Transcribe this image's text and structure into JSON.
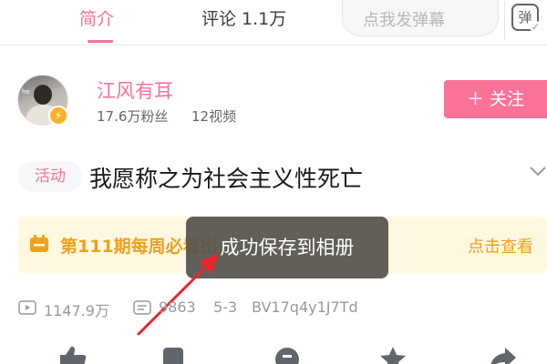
{
  "tabs": {
    "intro": "简介",
    "comments": "评论 1.1万"
  },
  "danmaku": {
    "placeholder": "点我发弹幕",
    "button_char": "弹"
  },
  "author": {
    "name": "江风有耳",
    "fans": "17.6万粉丝",
    "videos": "12视频",
    "avatar_tag": "he"
  },
  "follow_button": "＋ 关注",
  "activity_tag": "活动",
  "title": "我愿称之为社会主义性死亡",
  "banner": {
    "text": "第111期每周必看",
    "suffix": "出",
    "link": "点击查看"
  },
  "toast": "成功保存到相册",
  "stats": {
    "views": "1147.9万",
    "danmaku": "9863",
    "date": "5-3",
    "bvid": "BV17q4y1J7Td"
  },
  "colors": {
    "accent_pink": "#fb7299",
    "banner_orange": "#f0a020",
    "annotation_red": "#e8262c"
  },
  "icons": [
    "danmaku-icon",
    "verified-icon",
    "expand-icon",
    "calendar-icon",
    "play-icon",
    "danmaku-count-icon",
    "like-icon",
    "coin-icon",
    "favorite-icon",
    "share-icon"
  ]
}
